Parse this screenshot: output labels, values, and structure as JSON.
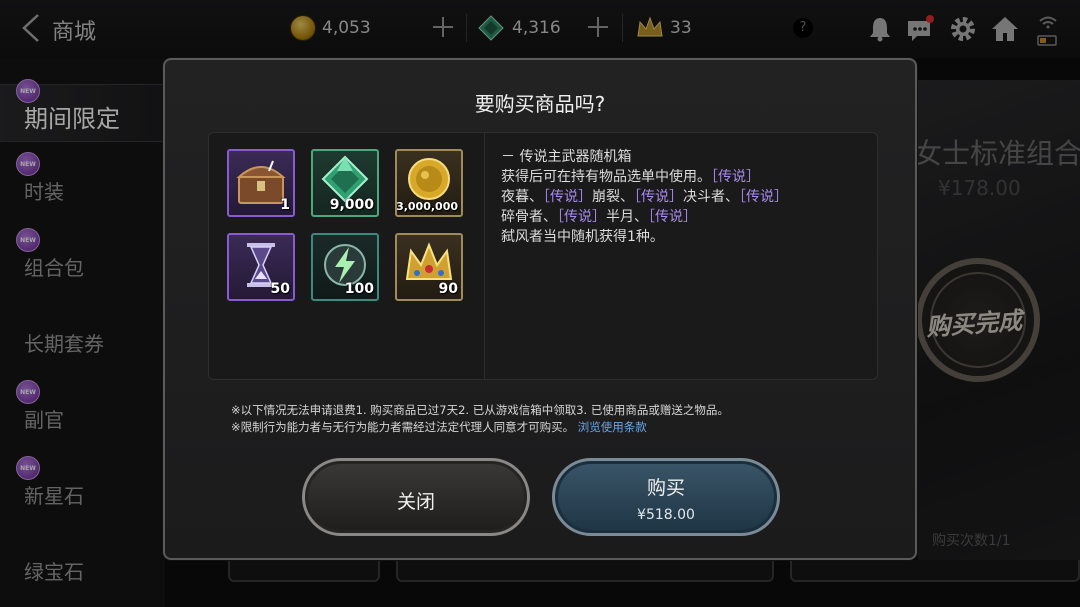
{
  "header": {
    "title": "商城",
    "gold": "4,053",
    "gems": "4,316",
    "crowns": "33",
    "help": "?"
  },
  "sidebar": {
    "items": [
      {
        "label": "期间限定",
        "new": true,
        "active": true
      },
      {
        "label": "时装",
        "new": true,
        "active": false
      },
      {
        "label": "组合包",
        "new": true,
        "active": false
      },
      {
        "label": "长期套券",
        "new": false,
        "active": false
      },
      {
        "label": "副官",
        "new": true,
        "active": false
      },
      {
        "label": "新星石",
        "new": true,
        "active": false
      },
      {
        "label": "绿宝石",
        "new": false,
        "active": false
      }
    ],
    "new_badge": "NEW"
  },
  "background": {
    "title": "女士标准组合",
    "price": "¥178.00",
    "stamp": "购买完成",
    "count": "购买次数1/1"
  },
  "dialog": {
    "title": "要购买商品吗?",
    "items": [
      {
        "icon": "treasure-chest-icon",
        "qty": "1",
        "rarity": "purple"
      },
      {
        "icon": "emerald-icon",
        "qty": "9,000",
        "rarity": "green"
      },
      {
        "icon": "gold-coin-icon",
        "qty": "3,000,000",
        "rarity": "gold"
      },
      {
        "icon": "hourglass-icon",
        "qty": "50",
        "rarity": "purple"
      },
      {
        "icon": "lightning-stone-icon",
        "qty": "100",
        "rarity": "teal"
      },
      {
        "icon": "crown-icon",
        "qty": "90",
        "rarity": "gold"
      }
    ],
    "desc": {
      "name": "－ 传说主武器随机箱",
      "l1a": "获得后可在持有物品选单中使用。",
      "t1": "［传说］",
      "l2a": "夜暮、",
      "t2": "［传说］",
      "l2b": "崩裂、",
      "t3": "［传说］",
      "l2c": "决斗者、",
      "t4": "［传说］",
      "l3a": "碎骨者、",
      "t5": "［传说］",
      "l3b": "半月、",
      "t6": "［传说］",
      "l4": "弑风者当中随机获得1种。"
    },
    "notice1": "※以下情况无法申请退费1. 购买商品已过7天2. 已从游戏信箱中领取3. 已使用商品或赠送之物品。",
    "notice2": "※限制行为能力者与无行为能力者需经过法定代理人同意才可购买。",
    "terms_link": "浏览使用条款",
    "close_label": "关闭",
    "buy_label": "购买",
    "buy_price": "¥518.00"
  }
}
